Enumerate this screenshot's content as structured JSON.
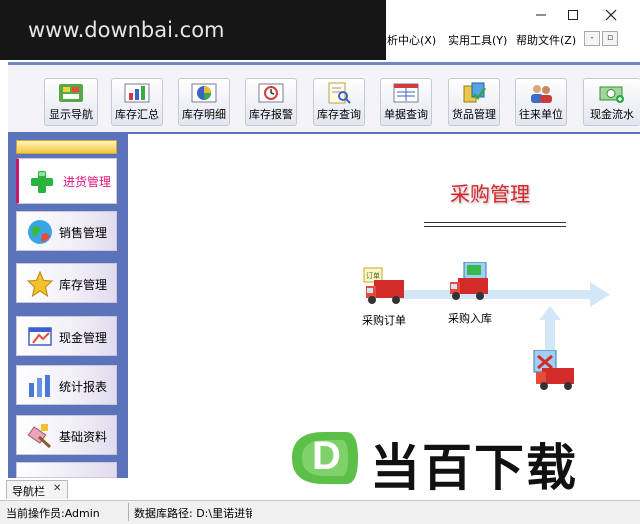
{
  "watermark": "www.downbai.com",
  "menu": [
    "分析中心(X)",
    "实用工具(Y)",
    "帮助文件(Z)"
  ],
  "mdi_controls": [
    "-",
    "▫"
  ],
  "toolbar": [
    {
      "label": "显示导航",
      "icon": "navigation-icon"
    },
    {
      "label": "库存汇总",
      "icon": "bar-chart-icon"
    },
    {
      "label": "库存明细",
      "icon": "pie-chart-icon"
    },
    {
      "label": "库存报警",
      "icon": "alarm-icon"
    },
    {
      "label": "库存查询",
      "icon": "search-document-icon"
    },
    {
      "label": "单据查询",
      "icon": "form-icon"
    },
    {
      "label": "货品管理",
      "icon": "goods-icon"
    },
    {
      "label": "往来单位",
      "icon": "users-icon"
    },
    {
      "label": "现金流水",
      "icon": "money-icon"
    }
  ],
  "nav": [
    {
      "label": "进货管理",
      "icon": "plus-icon",
      "active": true
    },
    {
      "label": "销售管理",
      "icon": "globe-icon"
    },
    {
      "label": "库存管理",
      "icon": "star-icon"
    },
    {
      "label": "现金管理",
      "icon": "cash-icon"
    },
    {
      "label": "统计报表",
      "icon": "report-icon"
    },
    {
      "label": "基础资料",
      "icon": "tools-icon"
    }
  ],
  "workspace": {
    "title": "采购管理",
    "items": [
      "采购订单",
      "采购入库"
    ]
  },
  "brand": {
    "letter": "D",
    "name": "当百下载"
  },
  "bottom_tab": {
    "label": "导航栏",
    "close": "✕"
  },
  "status": {
    "operator": "当前操作员:Admin",
    "db_path": "数据库路径: D:\\里诺进销存"
  }
}
